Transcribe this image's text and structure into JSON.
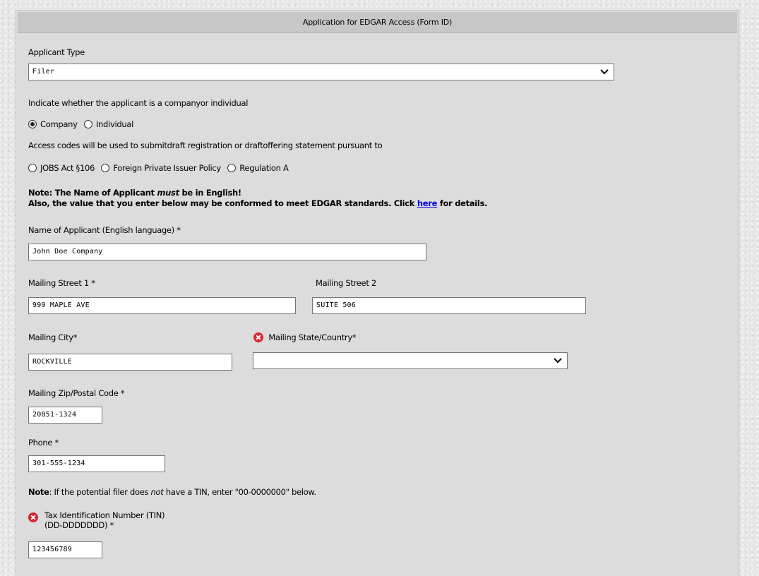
{
  "header": {
    "title": "Application for EDGAR Access (Form ID)"
  },
  "applicant_type": {
    "label": "Applicant Type",
    "value": "Filer"
  },
  "company_or_individual": {
    "prompt": "Indicate whether the applicant is a companyor individual",
    "options": [
      "Company",
      "Individual"
    ],
    "selected": "Company"
  },
  "access_codes": {
    "prompt": "Access codes will be used to submitdraft registration or draftoffering statement pursuant to",
    "options": [
      "JOBS Act §106",
      "Foreign Private Issuer Policy",
      "Regulation A"
    ]
  },
  "note_english": {
    "line1_pre": "Note:  The Name of Applicant ",
    "line1_em": "must",
    "line1_post": " be in English!",
    "line2_pre": " Also, the value that you enter below may be conformed to meet EDGAR standards. Click ",
    "line2_link": "here",
    "line2_post": " for details."
  },
  "fields": {
    "name": {
      "label": "Name of Applicant (English language) *",
      "value": "John Doe Company"
    },
    "street1": {
      "label": "Mailing Street 1 *",
      "value": "999 MAPLE AVE"
    },
    "street2": {
      "label": "Mailing Street 2",
      "value": "SUITE 506"
    },
    "city": {
      "label": "Mailing City*",
      "value": "ROCKVILLE"
    },
    "state": {
      "label": "Mailing State/Country*",
      "value": "",
      "error": true
    },
    "zip": {
      "label": "Mailing Zip/Postal Code *",
      "value": "20851-1324"
    },
    "phone": {
      "label": "Phone *",
      "value": "301-555-1234"
    },
    "tin": {
      "label_line1": "Tax Identification Number (TIN)",
      "label_line2": "(DD-DDDDDDD) *",
      "value": "123456789",
      "error": true
    }
  },
  "note_tin": {
    "bold": "Note",
    "pre": ": If the potential filer does ",
    "em": "not",
    "post": " have a TIN, enter \"00-0000000\" below."
  },
  "icons": {
    "error": "error-x-icon",
    "dropdown": "chevron-down-icon"
  },
  "colors": {
    "error": "#d9262c",
    "link": "#0000ee",
    "header_bg": "#c7c7c7",
    "panel_bg": "#dcdcdc"
  }
}
